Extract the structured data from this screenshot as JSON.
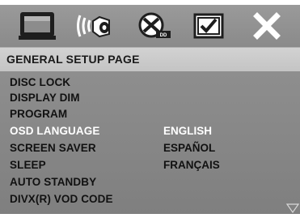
{
  "toolbar": {
    "icons": [
      {
        "name": "general-setup-icon",
        "selected": true
      },
      {
        "name": "audio-setup-icon",
        "selected": false
      },
      {
        "name": "dolby-digital-setup-icon",
        "selected": false
      },
      {
        "name": "preference-page-icon",
        "selected": false
      },
      {
        "name": "exit-icon",
        "selected": false
      }
    ]
  },
  "page": {
    "title": "GENERAL SETUP PAGE"
  },
  "menu": {
    "items": [
      {
        "label": "DISC LOCK"
      },
      {
        "label": "DISPLAY DIM"
      },
      {
        "label": "PROGRAM"
      },
      {
        "label": "OSD LANGUAGE",
        "selected": true
      },
      {
        "label": "SCREEN SAVER"
      },
      {
        "label": "SLEEP"
      },
      {
        "label": "AUTO STANDBY"
      },
      {
        "label": "DIVX(R) VOD CODE"
      }
    ],
    "options": [
      {
        "label": "ENGLISH",
        "selected": true
      },
      {
        "label": "ESPAÑOL"
      },
      {
        "label": "FRANÇAIS"
      }
    ]
  },
  "colors": {
    "selected_text": "#ffffff",
    "normal_text": "#111111",
    "menu_bg": "#888888",
    "title_bg": "#cccccc"
  }
}
